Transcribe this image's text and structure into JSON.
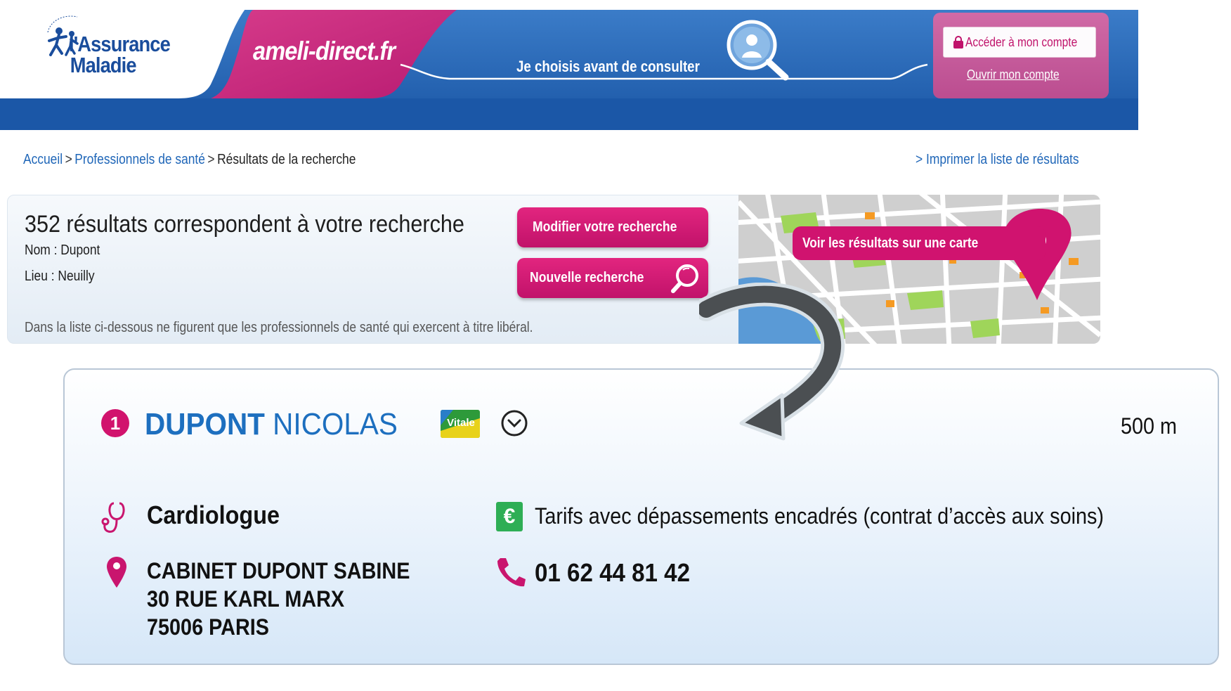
{
  "header": {
    "logo_line1": "l'Assurance",
    "logo_line2": "Maladie",
    "site_title": "ameli-direct.fr",
    "tagline": "Je choisis avant de consulter",
    "account_button": "Accéder à mon compte",
    "open_account_link": "Ouvrir mon compte"
  },
  "breadcrumb": {
    "items": [
      "Accueil",
      "Professionnels de santé",
      "Résultats de la recherche"
    ],
    "separator": ">",
    "print_link": "> Imprimer la liste de résultats"
  },
  "results": {
    "count_text": "352 résultats correspondent à votre recherche",
    "criteria_name": "Nom : Dupont",
    "criteria_place": "Lieu : Neuilly",
    "disclaimer": "Dans la liste ci-dessous ne figurent que les professionnels de santé qui exercent à titre libéral.",
    "modify_button": "Modifier votre recherche",
    "new_search_button": "Nouvelle recherche",
    "map_button": "Voir les résultats sur une carte"
  },
  "card": {
    "rank": "1",
    "last_name": "DUPONT",
    "first_name": "NICOLAS",
    "vitale_label": "Vitale",
    "distance": "500 m",
    "specialty": "Cardiologue",
    "tarifs": "Tarifs avec dépassements encadrés (contrat d’accès aux soins)",
    "euro_symbol": "€",
    "address_line1": "CABINET DUPONT SABINE",
    "address_line2": "30 RUE KARL MARX",
    "address_line3": "75006 PARIS",
    "phone": "01 62 44 81 42"
  },
  "colors": {
    "brand_blue": "#1f5fae",
    "brand_pink": "#c9156e",
    "link_blue": "#1f66b8",
    "euro_green": "#2eae55"
  },
  "icons": [
    "logo-figures-icon",
    "loupe-doctor-icon",
    "lock-icon",
    "magnifier-icon",
    "map-pin-icon",
    "vitale-card-icon",
    "clock-icon",
    "stethoscope-icon",
    "euro-icon",
    "location-pin-icon",
    "phone-icon",
    "curved-arrow-icon"
  ]
}
